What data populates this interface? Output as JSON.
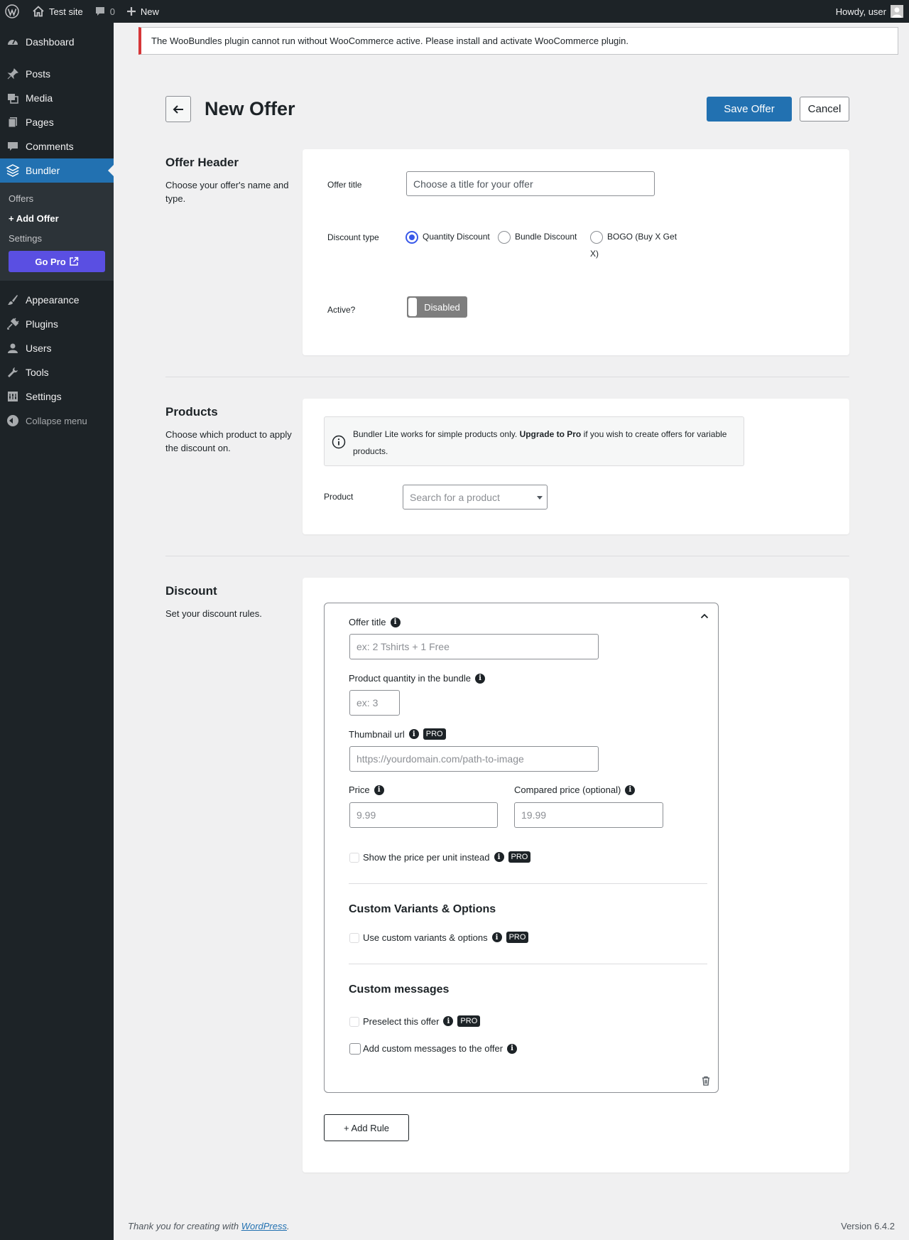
{
  "admin_bar": {
    "site_name": "Test site",
    "comments_count": "0",
    "new_label": "New",
    "greeting": "Howdy, user"
  },
  "sidebar": {
    "items_top": [
      {
        "label": "Dashboard",
        "icon": "dashboard-icon"
      },
      {
        "label": "Posts",
        "icon": "pin-icon"
      },
      {
        "label": "Media",
        "icon": "media-icon"
      },
      {
        "label": "Pages",
        "icon": "pages-icon"
      },
      {
        "label": "Comments",
        "icon": "comment-icon"
      },
      {
        "label": "Bundler",
        "icon": "layers-icon"
      }
    ],
    "submenu": [
      {
        "label": "Offers"
      },
      {
        "label": "+ Add Offer"
      },
      {
        "label": "Settings"
      }
    ],
    "go_pro": "Go Pro",
    "items_bottom": [
      {
        "label": "Appearance",
        "icon": "brush-icon"
      },
      {
        "label": "Plugins",
        "icon": "plug-icon"
      },
      {
        "label": "Users",
        "icon": "user-icon"
      },
      {
        "label": "Tools",
        "icon": "wrench-icon"
      },
      {
        "label": "Settings",
        "icon": "settings-icon"
      }
    ],
    "collapse": "Collapse menu"
  },
  "notice": "The WooBundles plugin cannot run without WooCommerce active. Please install and activate WooCommerce plugin.",
  "page": {
    "title": "New Offer",
    "save": "Save Offer",
    "cancel": "Cancel"
  },
  "offer_header": {
    "title": "Offer Header",
    "desc": "Choose your offer's name and type.",
    "offer_title_label": "Offer title",
    "offer_title_placeholder": "Choose a title for your offer",
    "discount_type_label": "Discount type",
    "discount_options": [
      "Quantity Discount",
      "Bundle Discount",
      "BOGO (Buy X Get X)"
    ],
    "selected_option": "Quantity Discount",
    "active_label": "Active?",
    "toggle_text": "Disabled"
  },
  "products": {
    "title": "Products",
    "desc": "Choose which product to apply the discount on.",
    "info_prefix": "Bundler Lite works for simple products only.",
    "info_bold": "Upgrade to Pro",
    "info_suffix": "if you wish to create offers for variable products.",
    "product_label": "Product",
    "product_placeholder": "Search for a product"
  },
  "discount": {
    "title": "Discount",
    "desc": "Set your discount rules.",
    "rule": {
      "offer_title_label": "Offer title",
      "offer_title_placeholder": "ex: 2 Tshirts + 1 Free",
      "qty_label": "Product quantity in the bundle",
      "qty_placeholder": "ex: 3",
      "thumb_label": "Thumbnail url",
      "thumb_placeholder": "https://yourdomain.com/path-to-image",
      "price_label": "Price",
      "price_placeholder": "9.99",
      "compared_label": "Compared price (optional)",
      "compared_placeholder": "19.99",
      "per_unit_label": "Show the price per unit instead",
      "variants_heading": "Custom Variants & Options",
      "variants_label": "Use custom variants & options",
      "messages_heading": "Custom messages",
      "preselect_label": "Preselect this offer",
      "custom_messages_label": "Add custom messages to the offer",
      "pro_badge": "PRO"
    },
    "add_rule": "+ Add Rule"
  },
  "footer": {
    "thanks_prefix": "Thank you for creating with",
    "thanks_link": "WordPress",
    "thanks_suffix": ".",
    "version": "Version 6.4.2"
  }
}
